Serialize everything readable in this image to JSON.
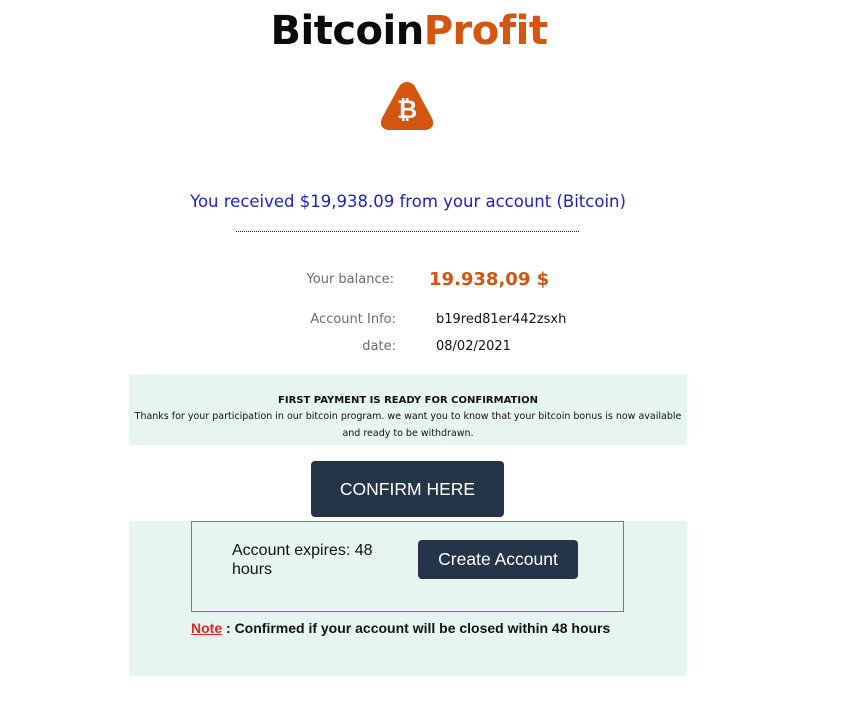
{
  "brand": {
    "part1": "Bitcoin",
    "part2": "Profit",
    "logo_icon": "bitcoin-triangle-logo",
    "logo_symbol": "₿"
  },
  "message": {
    "received": "You received $19,938.09 from your account (Bitcoin)"
  },
  "account": {
    "balance_label": "Your balance:",
    "balance_value": "19.938,09 $",
    "info_label": "Account Info:",
    "info_value": "b19red81er442zsxh",
    "date_label": "date:",
    "date_value": "08/02/2021"
  },
  "notice": {
    "title": "FIRST PAYMENT IS READY FOR CONFIRMATION",
    "body": "Thanks for your participation in our bitcoin program. we want you to know that your bitcoin bonus is now available and ready to be withdrawn."
  },
  "actions": {
    "confirm_label": "CONFIRM HERE",
    "create_label": "Create Account"
  },
  "expiry": {
    "text": "Account expires: 48 hours"
  },
  "note": {
    "link_label": "Note",
    "text": " : Confirmed if your account will be closed within 48 hours"
  },
  "colors": {
    "brand_accent": "#d45510",
    "link_blue": "#1b22c8",
    "button_bg": "#243548",
    "panel_bg": "#e6f6ee",
    "note_red": "#e0252a",
    "box_border": "#e0533a"
  }
}
